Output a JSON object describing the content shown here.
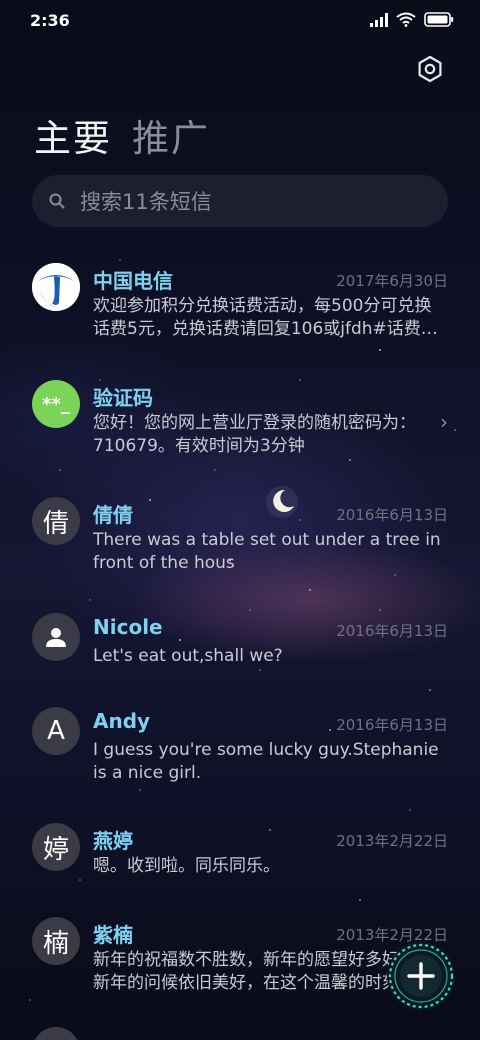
{
  "status_bar": {
    "time": "2:36"
  },
  "tabs": [
    {
      "label": "主要",
      "active": true
    },
    {
      "label": "推广",
      "active": false
    }
  ],
  "search": {
    "placeholder": "搜索11条短信"
  },
  "messages": [
    {
      "name": "中国电信",
      "date": "2017年6月30日",
      "preview": "欢迎参加积分兑换话费活动，每500分可兑换话费5元，兑换话费请回复106或jfdh#话费…",
      "avatar": "telecom-logo"
    },
    {
      "name": "验证码",
      "date": "",
      "preview": "您好！您的网上营业厅登录的随机密码为：710679。有效时间为3分钟",
      "avatar_text": "**_"
    },
    {
      "name": "倩倩",
      "date": "2016年6月13日",
      "preview": "There was a table set out under a tree in front of the hous",
      "avatar_text": "倩"
    },
    {
      "name": "Nicole",
      "date": "2016年6月13日",
      "preview": "Let's eat out,shall we?",
      "avatar": "person-icon"
    },
    {
      "name": "Andy",
      "date": "2016年6月13日",
      "preview": "I guess you're some lucky guy.Stephanie is a nice girl.",
      "avatar_text": "A"
    },
    {
      "name": "燕婷",
      "date": "2013年2月22日",
      "preview": "嗯。收到啦。同乐同乐。",
      "avatar_text": "婷"
    },
    {
      "name": "紫楠",
      "date": "2013年2月22日",
      "preview": "新年的祝福数不胜数，新年的愿望好多好多，新年的问候依旧美好，在这个温馨的时刻",
      "avatar_text": "楠"
    }
  ],
  "colors": {
    "name": "#7fd1f2",
    "verification_avatar": "#7bd35a",
    "telecom": "#1a5fb4"
  }
}
